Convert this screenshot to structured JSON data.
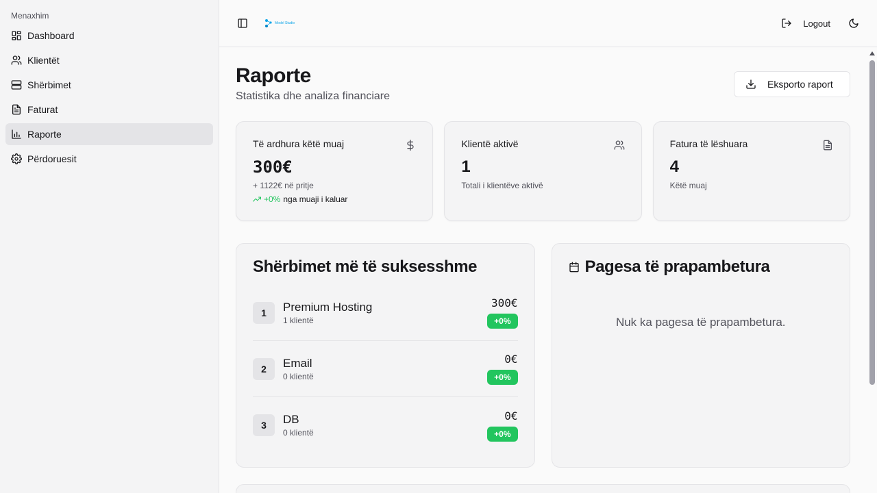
{
  "sidebar": {
    "group_label": "Menaxhim",
    "items": [
      {
        "label": "Dashboard",
        "icon": "dashboard-icon"
      },
      {
        "label": "Klientët",
        "icon": "users-icon"
      },
      {
        "label": "Shërbimet",
        "icon": "server-icon"
      },
      {
        "label": "Faturat",
        "icon": "file-text-icon"
      },
      {
        "label": "Raporte",
        "icon": "bar-chart-icon",
        "active": true
      },
      {
        "label": "Përdoruesit",
        "icon": "gear-icon"
      }
    ]
  },
  "header": {
    "logo_text": "Model Studio",
    "logout_label": "Logout"
  },
  "page": {
    "title": "Raporte",
    "subtitle": "Statistika dhe analiza financiare",
    "export_label": "Eksporto raport"
  },
  "stats": [
    {
      "title": "Të ardhura këtë muaj",
      "value": "300€",
      "sub": "+ 1122€ në pritje",
      "trend_value": "+0%",
      "trend_text": "nga muaji i kaluar",
      "icon": "dollar-icon"
    },
    {
      "title": "Klientë aktivë",
      "value": "1",
      "sub": "Totali i klientëve aktivë",
      "icon": "users-icon"
    },
    {
      "title": "Fatura të lëshuara",
      "value": "4",
      "sub": "Këtë muaj",
      "icon": "file-text-icon"
    }
  ],
  "top_services": {
    "title": "Shërbimet më të suksesshme",
    "items": [
      {
        "rank": "1",
        "name": "Premium Hosting",
        "clients": "1 klientë",
        "value": "300€",
        "change": "+0%"
      },
      {
        "rank": "2",
        "name": "Email",
        "clients": "0 klientë",
        "value": "0€",
        "change": "+0%"
      },
      {
        "rank": "3",
        "name": "DB",
        "clients": "0 klientë",
        "value": "0€",
        "change": "+0%"
      }
    ]
  },
  "overdue": {
    "title": "Pagesa të prapambetura",
    "empty_message": "Nuk ka pagesa të prapambetura."
  },
  "colors": {
    "accent_green": "#22c55e",
    "sidebar_bg": "#f4f4f5",
    "active_bg": "#e4e4e7",
    "logo_blue": "#0ea5e9"
  }
}
